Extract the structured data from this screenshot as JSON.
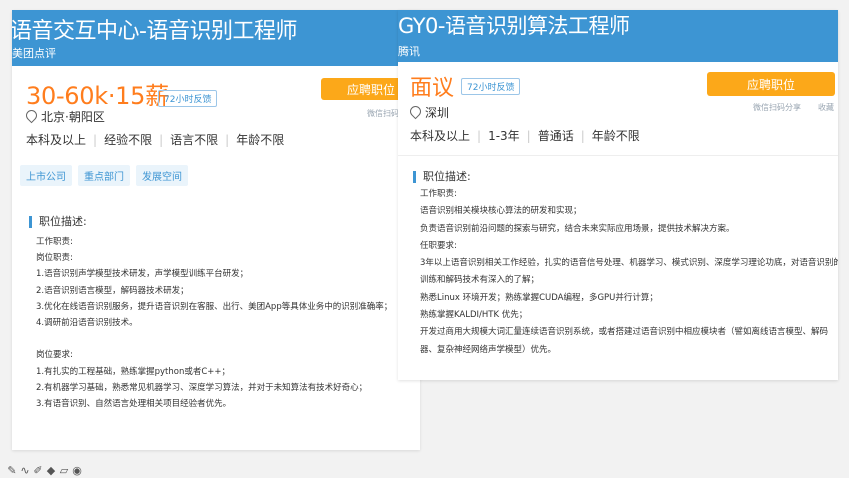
{
  "left": {
    "title": "语音交互中心-语音识别工程师",
    "company": "美团点评",
    "salary": "30-60k·15薪",
    "badge": "72小时反馈",
    "apply": "应聘职位",
    "share": "微信扫码分",
    "location": "北京·朝阳区",
    "reqs": [
      "本科及以上",
      "经验不限",
      "语言不限",
      "年龄不限"
    ],
    "tags": [
      "上市公司",
      "重点部门",
      "发展空间"
    ],
    "section": "职位描述:",
    "desc": [
      "工作职责:",
      "岗位职责:",
      "1.语音识别声学模型技术研发，声学模型训练平台研发；",
      "2.语音识别语言模型，解码器技术研发；",
      "3.优化在线语音识别服务，提升语音识别在客服、出行、美团App等具体业务中的识别准确率；",
      "4.调研前沿语音识别技术。",
      "",
      "岗位要求:",
      "1.有扎实的工程基础，熟练掌握python或者C++；",
      "2.有机器学习基础，熟悉常见机器学习、深度学习算法，并对于未知算法有技术好奇心；",
      "3.有语音识别、自然语言处理相关项目经验者优先。"
    ]
  },
  "right": {
    "title": "GY0-语音识别算法工程师",
    "company": "腾讯",
    "salary": "面议",
    "badge": "72小时反馈",
    "apply": "应聘职位",
    "share": "微信扫码分享",
    "collect": "收藏",
    "location": "深圳",
    "reqs": [
      "本科及以上",
      "1-3年",
      "普通话",
      "年龄不限"
    ],
    "section": "职位描述:",
    "desc": [
      "工作职责:",
      "语音识别相关模块核心算法的研发和实现；",
      "负责语音识别前沿问题的探索与研究，结合未来实际应用场景，提供技术解决方案。",
      "任职要求:",
      "3年以上语音识别相关工作经验，扎实的语音信号处理、机器学习、模式识别、深度学习理论功底，对语音识别的",
      "训练和解码技术有深入的了解；",
      "熟悉Linux 环境开发；熟练掌握CUDA编程，多GPU并行计算；",
      "熟练掌握KALDI/HTK 优先；",
      "开发过商用大规模大词汇量连续语音识别系统，或者搭建过语音识别中相应模块者（譬如离线语言模型、解码",
      "器、复杂神经网络声学模型）优先。"
    ]
  },
  "toolbar": [
    "pen-tool",
    "curve-tool",
    "pencil-tool",
    "eraser-tool",
    "shape-tool",
    "record-tool"
  ]
}
